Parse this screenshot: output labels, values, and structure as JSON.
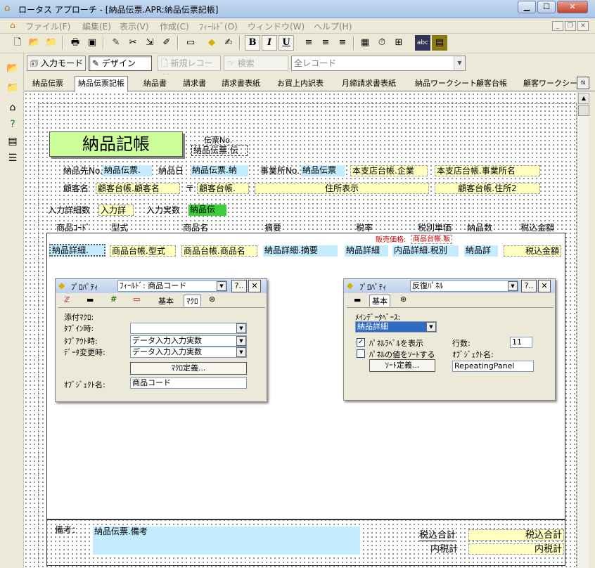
{
  "window": {
    "title": "ロータス アプローチ - [納品伝票.APR:納品伝票記帳]",
    "buttons": {
      "minimize": "▁",
      "maximize": "☐",
      "close": "✕"
    }
  },
  "menubar": {
    "items": [
      "ファイル(F)",
      "編集(E)",
      "表示(V)",
      "作成(C)",
      "ﾌｨｰﾙﾄﾞ(O)",
      "ウィンドウ(W)",
      "ヘルプ(H)"
    ],
    "mdi": {
      "minimize": "_",
      "restore": "❐",
      "close": "✕"
    }
  },
  "toolbar": {
    "bold": "B",
    "italic": "I",
    "underline": "U"
  },
  "modebar": {
    "input_mode": "入力モード",
    "design": "デザイン",
    "new_record": "新規レコード",
    "search": "検索",
    "record_filter": "全レコード"
  },
  "tabs": [
    "納品伝票",
    "納品伝票記帳",
    "納品書",
    "請求書",
    "請求書表紙",
    "お買上内訳表",
    "月締請求書表紙",
    "納品ワークシート",
    "顧客台帳",
    "顧客ワークシート"
  ],
  "form": {
    "title": "納品記帳",
    "voucher_no_label": "伝票No.",
    "voucher_no_field": "納品伝票.伝",
    "delivery_no_label": "納品先No.",
    "delivery_no_field": "納品伝票.",
    "delivery_date_label": "納品日",
    "delivery_date_field": "納品伝票.納",
    "office_no_label": "事業所No.",
    "office_no_field": "納品伝票",
    "hq_company_field": "本支店台帳.企業",
    "hq_office_field": "本支店台帳.事業所名",
    "customer_label": "顧客名",
    "customer_field": "顧客台帳.顧客名",
    "zip_mark": "〒",
    "zip_field": "顧客台帳.",
    "address_field": "住所表示",
    "address2_field": "顧客台帳.住所2",
    "entry_count_label": "入力詳細数",
    "entry_count_field": "入力詳",
    "entry_actual_label": "入力実数",
    "entry_actual_field": "納品伝",
    "columns": [
      "商品ｺｰﾄﾞ",
      "型式",
      "商品名",
      "摘要",
      "税率",
      "税別単価",
      "納品数",
      "税込金額"
    ],
    "sale_price_label": "販売価格:",
    "sale_price_field": "商品台帳.販",
    "row_fields": [
      "納品詳細.",
      "商品台帳.型式",
      "商品台帳.商品名",
      "納品詳細.摘要",
      "納品詳細",
      "内品詳細.税別",
      "納品詳",
      "税込金額"
    ],
    "notes_label": "備考：",
    "notes_field": "納品伝票.備考",
    "total_tax_label": "税込合計",
    "total_tax_field": "税込合計",
    "inner_tax_label": "内税計",
    "inner_tax_field": "内税計"
  },
  "prop_left": {
    "title": "ﾌﾟﾛﾊﾟﾃｨ",
    "target": "ﾌｨｰﾙﾄﾞ: 商品コード",
    "help": "?..",
    "close": "✕",
    "tab_basic": "基本",
    "tab_macro": "ﾏｸﾛ",
    "attached_macro": "添付ﾏｸﾛ:",
    "tab_in": "ﾀﾌﾞｲﾝ時:",
    "tab_in_value": "",
    "tab_out": "ﾀﾌﾞｱｳﾄ時:",
    "tab_out_value": "データ入力入力実数",
    "data_change": "ﾃﾞｰﾀ変更時:",
    "data_change_value": "データ入力入力実数",
    "macro_define": "ﾏｸﾛ定義...",
    "object_name_label": "ｵﾌﾞｼﾞｪｸﾄ名:",
    "object_name": "商品コード"
  },
  "prop_right": {
    "title": "ﾌﾟﾛﾊﾟﾃｨ",
    "target": "反復ﾊﾟﾈﾙ",
    "help": "?..",
    "close": "✕",
    "tab_basic": "基本",
    "main_db_label": "ﾒｲﾝﾃﾞｰﾀﾍﾞｰｽ:",
    "main_db": "納品詳細",
    "show_label": "ﾊﾟﾈﾙﾗﾍﾞﾙを表示",
    "show_checked": "✓",
    "sort_values": "ﾊﾟﾈﾙの値をｿｰﾄする",
    "rows_label": "行数:",
    "rows": "11",
    "object_name_label": "ｵﾌﾞｼﾞｪｸﾄ名:",
    "object_name": "RepeatingPanel",
    "sort_define": "ｿｰﾄ定義..."
  }
}
